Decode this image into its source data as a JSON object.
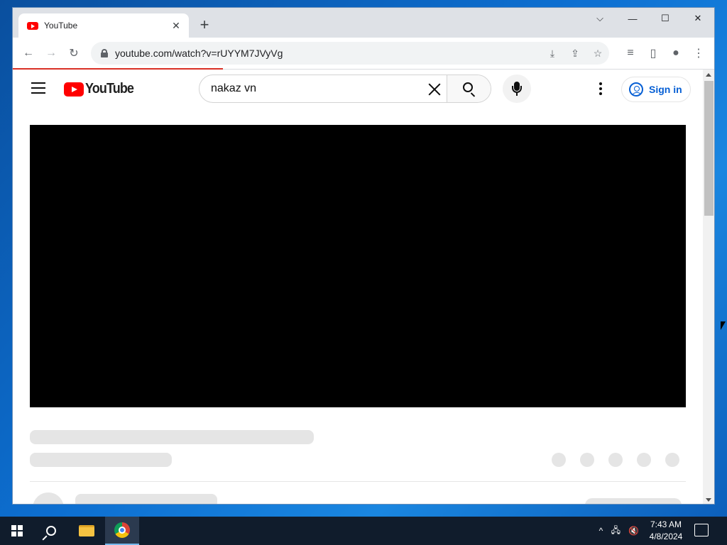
{
  "browser": {
    "tab_title": "YouTube",
    "new_tab": "+",
    "url": "youtube.com/watch?v=rUYYM7JVyVg"
  },
  "youtube": {
    "logo_text": "YouTube",
    "search_value": "nakaz vn",
    "sign_in": "Sign in"
  },
  "taskbar": {
    "time": "7:43 AM",
    "date": "4/8/2024"
  },
  "page_progress": 0.3
}
